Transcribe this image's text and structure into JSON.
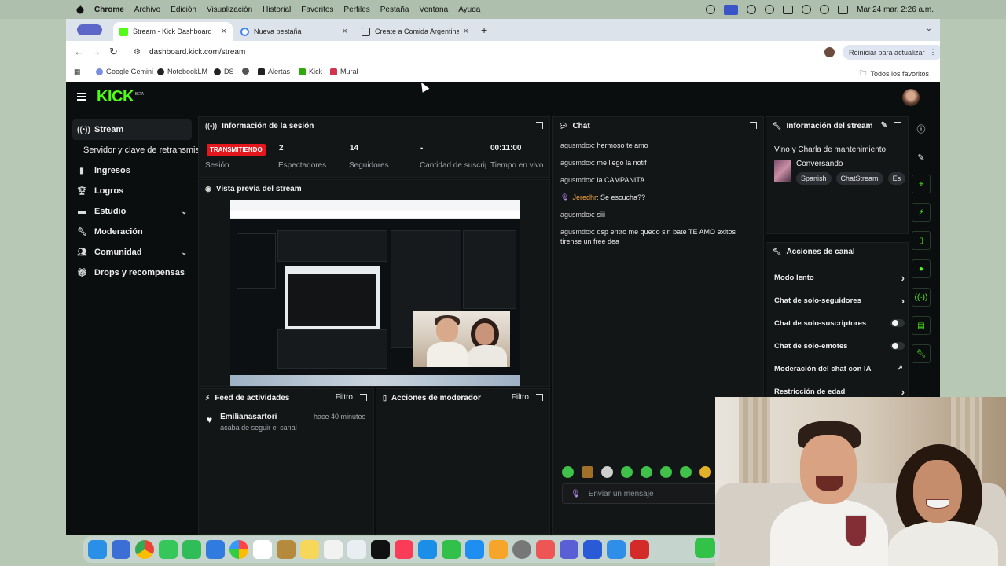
{
  "menubar": {
    "app": "Chrome",
    "items": [
      "Archivo",
      "Edición",
      "Visualización",
      "Historial",
      "Favoritos",
      "Perfiles",
      "Pestaña",
      "Ventana",
      "Ayuda"
    ],
    "clock": "Mar 24 mar. 2:26 a.m."
  },
  "browser": {
    "tabs": [
      {
        "title": "Stream - Kick Dashboard",
        "active": true
      },
      {
        "title": "Nueva pestaña",
        "active": false
      },
      {
        "title": "Create a Comida Argentina d",
        "active": false
      }
    ],
    "url": "dashboard.kick.com/stream",
    "restart_label": "Reiniciar para actualizar",
    "bookmarks": [
      "Google Gemini",
      "NotebookLM",
      "DS",
      "",
      "Alertas",
      "Kick",
      "Mural"
    ],
    "all_bookmarks": "Todos los favoritos"
  },
  "kick": {
    "logo": "KICK",
    "logo_badge": "BETA",
    "sidebar": [
      {
        "label": "Stream",
        "icon": "live-icon"
      },
      {
        "label": "Servidor y clave de retransmisión",
        "icon": "",
        "sub": true
      },
      {
        "label": "Ingresos",
        "icon": "bar-chart-icon"
      },
      {
        "label": "Logros",
        "icon": "trophy-icon"
      },
      {
        "label": "Estudio",
        "icon": "studio-icon",
        "caret": true
      },
      {
        "label": "Moderación",
        "icon": "wrench-icon"
      },
      {
        "label": "Comunidad",
        "icon": "community-icon",
        "caret": true
      },
      {
        "label": "Drops y recompensas",
        "icon": "gift-icon"
      }
    ],
    "session": {
      "title": "Información de la sesión",
      "status": "TRANSMITIENDO",
      "status_label": "Sesión",
      "viewers": "2",
      "viewers_label": "Espectadores",
      "followers": "14",
      "followers_label": "Seguidores",
      "subs": "-",
      "subs_label": "Cantidad de suscripciones",
      "time": "00:11:00",
      "time_label": "Tiempo en vivo"
    },
    "preview": {
      "title": "Vista previa del stream"
    },
    "feed": {
      "title": "Feed de actividades",
      "filter": "Filtro",
      "items": [
        {
          "name": "Emilianasartori",
          "action": "acaba de seguir el canal",
          "time": "hace 40 minutos"
        }
      ]
    },
    "mod_actions": {
      "title": "Acciones de moderador",
      "filter": "Filtro"
    },
    "chat": {
      "title": "Chat",
      "messages": [
        {
          "user": "agusmdox",
          "text": "hermoso te amo"
        },
        {
          "user": "agusmdox",
          "text": "me llego la notif"
        },
        {
          "user": "agusmdox",
          "text": "la CAMPANITA"
        },
        {
          "user": "Jeredhr",
          "text": "Se escucha??"
        },
        {
          "user": "agusmdox",
          "text": "siii"
        },
        {
          "user": "agusmdox",
          "text": "dsp entro me quedo sin bate TE AMO exitos tirense un free dea"
        }
      ],
      "input_placeholder": "Enviar un mensaje"
    },
    "stream_info": {
      "title": "Información del stream",
      "stream_title": "Vino y Charla de mantenimiento",
      "category": "Conversando",
      "tags": [
        "Spanish",
        "ChatStream",
        "Es"
      ]
    },
    "channel_actions": {
      "title": "Acciones de canal",
      "rows": [
        {
          "label": "Modo lento",
          "control": "arrow"
        },
        {
          "label": "Chat de solo-seguidores",
          "control": "arrow"
        },
        {
          "label": "Chat de solo-suscriptores",
          "control": "toggle"
        },
        {
          "label": "Chat de solo-emotes",
          "control": "toggle"
        },
        {
          "label": "Moderación del chat con IA",
          "control": "icon"
        },
        {
          "label": "Restricción de edad",
          "control": "arrow"
        }
      ]
    }
  }
}
